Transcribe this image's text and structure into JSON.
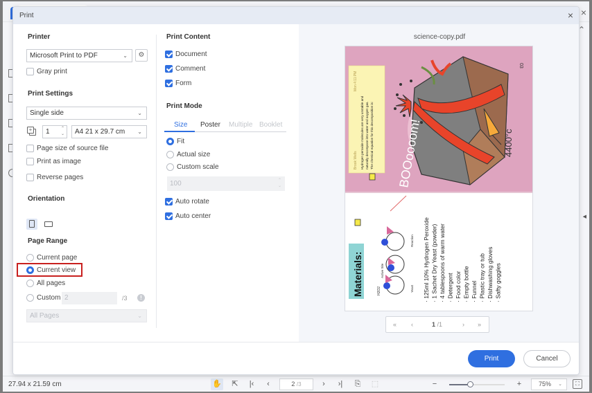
{
  "dialog": {
    "title": "Print",
    "close_icon": "×"
  },
  "printer": {
    "section_title": "Printer",
    "selected": "Microsoft Print to PDF",
    "gray_print": {
      "label": "Gray print",
      "checked": false
    }
  },
  "print_settings": {
    "section_title": "Print Settings",
    "duplex": "Single side",
    "copies": "1",
    "paper_size": "A4 21 x 29.7 cm",
    "options": [
      {
        "label": "Page size of source file",
        "checked": false
      },
      {
        "label": "Print as image",
        "checked": false
      },
      {
        "label": "Reverse pages",
        "checked": false
      }
    ]
  },
  "orientation": {
    "section_title": "Orientation",
    "selected": "portrait"
  },
  "page_range": {
    "section_title": "Page Range",
    "options": [
      {
        "label": "Current page",
        "checked": false
      },
      {
        "label": "Current view",
        "checked": true
      },
      {
        "label": "All pages",
        "checked": false
      },
      {
        "label": "Custom",
        "checked": false
      }
    ],
    "custom_value": "2",
    "custom_total": "/3",
    "info_icon": "!",
    "subset_select": "All Pages"
  },
  "print_content": {
    "section_title": "Print Content",
    "options": [
      {
        "label": "Document",
        "checked": true
      },
      {
        "label": "Comment",
        "checked": true
      },
      {
        "label": "Form",
        "checked": true
      }
    ]
  },
  "print_mode": {
    "section_title": "Print Mode",
    "tabs": [
      {
        "label": "Size",
        "state": "active"
      },
      {
        "label": "Poster",
        "state": "normal"
      },
      {
        "label": "Multiple",
        "state": "disabled"
      },
      {
        "label": "Booklet",
        "state": "disabled"
      }
    ],
    "scale_options": [
      {
        "label": "Fit",
        "checked": true
      },
      {
        "label": "Actual size",
        "checked": false
      },
      {
        "label": "Custom scale",
        "checked": false
      }
    ],
    "custom_scale_value": "100",
    "auto_options": [
      {
        "label": "Auto rotate",
        "checked": true
      },
      {
        "label": "Auto center",
        "checked": true
      }
    ]
  },
  "preview": {
    "filename": "science-copy.pdf",
    "page_current": "1",
    "page_total": "/1",
    "page_text": {
      "page_number": "03",
      "comment_author": "Brook Wells",
      "comment_time": "Mon 4:11 PM",
      "comment_body": "Hydrogen peroxide molecules are very unstable and naturally decompose into water and oxygen gas. The chemical equation for this decomposition is:",
      "boom": "BOOoooom!",
      "temperature": "4400°c",
      "materials_title": "Materials:",
      "materials": [
        "125ml 10% Hydrogen Peroxide",
        "1 Sachet Dry Yeast (powder)",
        "4 tablespoons of warm water",
        "Detergent",
        "Food color",
        "Empty bottle",
        "Funnel",
        "Plastic tray or tub",
        "Dishwashing gloves",
        "Safty goggles"
      ],
      "diagram_labels": [
        "H2O2",
        "Active Site",
        "Yeast",
        "Reaction"
      ]
    },
    "colors": {
      "page_pink": "#dea4bf",
      "lava": "#e8442a",
      "comment_yellow": "#fbf4b4",
      "materials_teal": "#8fd4d4"
    }
  },
  "buttons": {
    "print": "Print",
    "cancel": "Cancel"
  },
  "statusbar": {
    "dimensions": "27.94 x 21.59 cm",
    "page_current": "2",
    "page_total": "/3",
    "zoom_level": "75%",
    "zoom_fraction": 0.38
  },
  "colors": {
    "accent": "#2f6fe0",
    "highlight_border": "#c8201f",
    "dialog_titlebar": "#e6ebf4"
  }
}
